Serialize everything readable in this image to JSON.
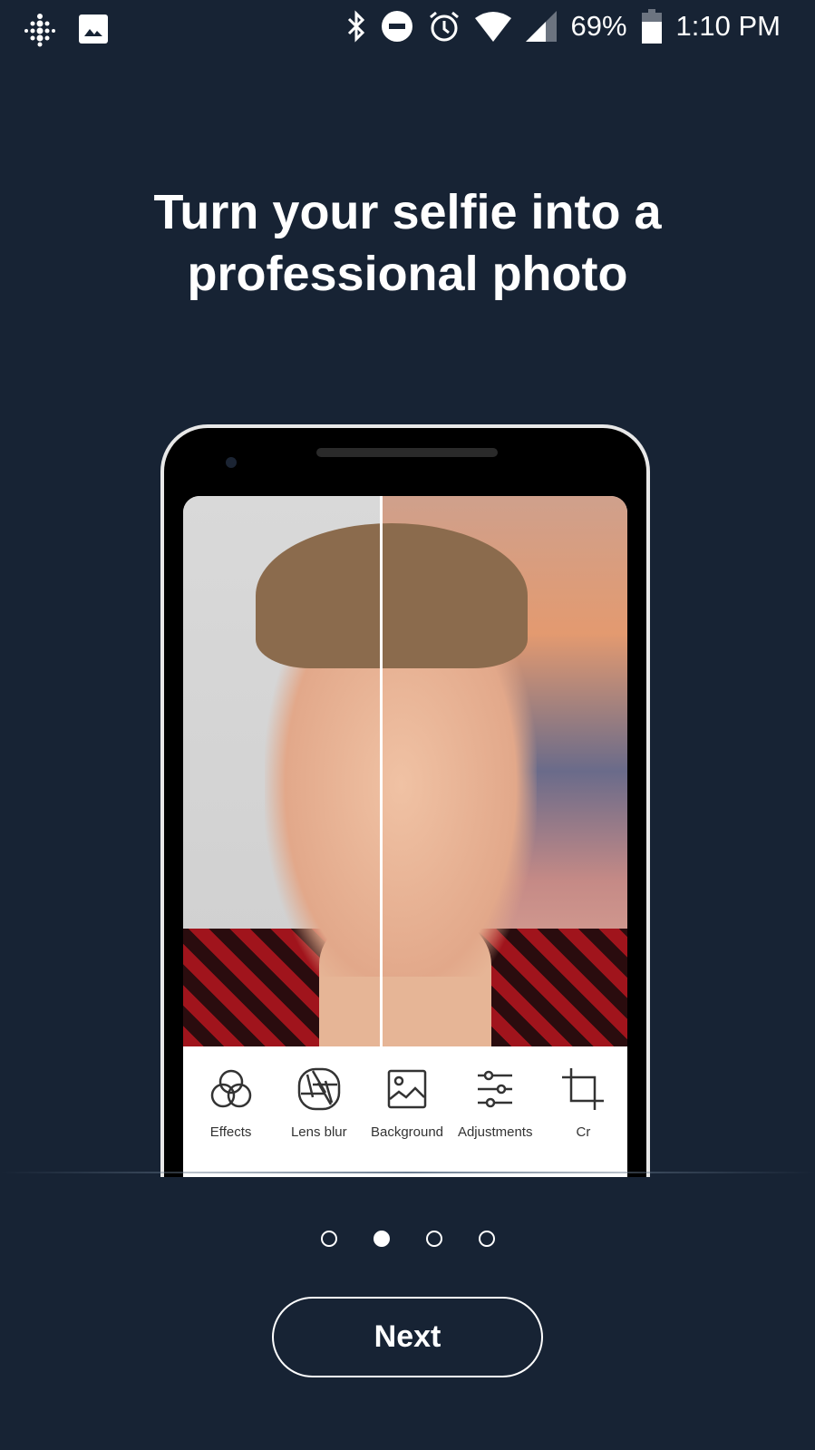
{
  "status_bar": {
    "battery": "69%",
    "time": "1:10 PM",
    "icons": [
      "fitbit-icon",
      "image-icon",
      "bluetooth-icon",
      "do-not-disturb-icon",
      "alarm-icon",
      "wifi-icon",
      "signal-icon",
      "battery-icon"
    ]
  },
  "onboarding": {
    "title_line1": "Turn your selfie into a",
    "title_line2": "professional photo",
    "page_count": 4,
    "active_page": 2,
    "next_label": "Next"
  },
  "tools": [
    {
      "label": "Effects",
      "icon": "effects-icon"
    },
    {
      "label": "Lens blur",
      "icon": "aperture-icon"
    },
    {
      "label": "Background",
      "icon": "image-icon"
    },
    {
      "label": "Adjustments",
      "icon": "sliders-icon"
    },
    {
      "label": "Cr",
      "icon": "crop-icon"
    }
  ],
  "colors": {
    "background": "#172334"
  }
}
